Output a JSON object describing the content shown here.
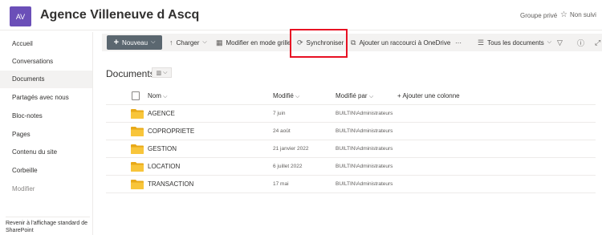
{
  "header": {
    "logo_initials": "AV",
    "site_title": "Agence Villeneuve d Ascq",
    "privacy": "Groupe privé",
    "follow_label": "Non suivi"
  },
  "nav": {
    "items": [
      "Accueil",
      "Conversations",
      "Documents",
      "Partagés avec nous",
      "Bloc-notes",
      "Pages",
      "Contenu du site",
      "Corbeille",
      "Modifier"
    ],
    "selected": "Documents",
    "footer": "Revenir à l'affichage standard de SharePoint"
  },
  "toolbar": {
    "new_label": "Nouveau",
    "upload_label": "Charger",
    "grid_edit_label": "Modifier en mode grille",
    "sync_label": "Synchroniser",
    "shortcut_label": "Ajouter un raccourci à OneDrive",
    "more_label": "···",
    "view_label": "Tous les documents"
  },
  "library": {
    "title": "Documents",
    "columns": {
      "name": "Nom",
      "modified": "Modifié",
      "modified_by": "Modifié par",
      "add_column": "Ajouter une colonne"
    },
    "rows": [
      {
        "name": "AGENCE",
        "modified": "7 juin",
        "modified_by": "BUILTIN\\Administrateurs"
      },
      {
        "name": "COPROPRIETE",
        "modified": "24 août",
        "modified_by": "BUILTIN\\Administrateurs"
      },
      {
        "name": "GESTION",
        "modified": "21 janvier 2022",
        "modified_by": "BUILTIN\\Administrateurs"
      },
      {
        "name": "LOCATION",
        "modified": "6 juillet 2022",
        "modified_by": "BUILTIN\\Administrateurs"
      },
      {
        "name": "TRANSACTION",
        "modified": "17 mai",
        "modified_by": "BUILTIN\\Administrateurs"
      }
    ]
  },
  "colors": {
    "folder": "#f8c53a",
    "folder_dark": "#e8a918",
    "new_button": "#5b6770",
    "highlight": "#e81123",
    "logo": "#6b4fb8"
  }
}
